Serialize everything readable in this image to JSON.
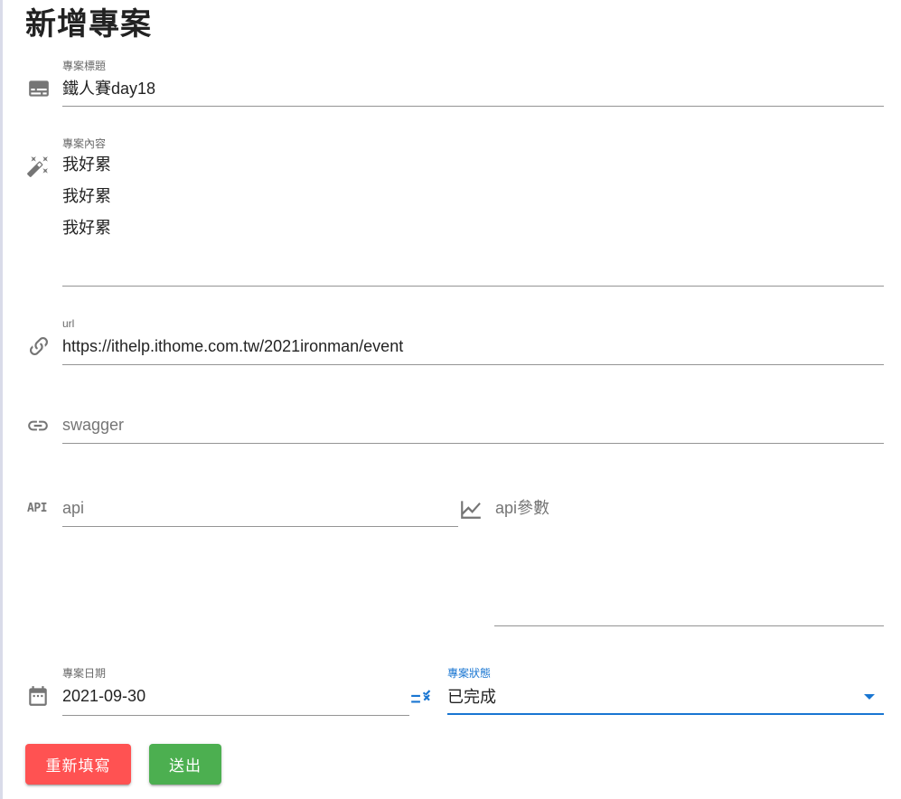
{
  "page": {
    "title": "新增專案"
  },
  "form": {
    "title_field": {
      "label": "專案標題",
      "value": "鐵人賽day18",
      "icon": "subtitles-icon"
    },
    "content_field": {
      "label": "專案內容",
      "lines": [
        "我好累",
        "我好累",
        "我好累"
      ],
      "icon": "auto-fix-icon"
    },
    "url_field": {
      "label": "url",
      "value": "https://ithelp.ithome.com.tw/2021ironman/event",
      "icon": "link-variant-icon"
    },
    "swagger_field": {
      "placeholder": "swagger",
      "icon": "link-icon"
    },
    "api_field": {
      "placeholder": "api",
      "icon": "api-icon",
      "icon_text": "API"
    },
    "api_params_field": {
      "placeholder": "api參數",
      "icon": "chart-line-icon"
    },
    "date_field": {
      "label": "專案日期",
      "value": "2021-09-30",
      "icon": "calendar-icon"
    },
    "status_field": {
      "label": "專案狀態",
      "value": "已完成",
      "icon": "list-status-icon"
    }
  },
  "buttons": {
    "reset_label": "重新填寫",
    "submit_label": "送出"
  },
  "colors": {
    "accent": "#1976d2",
    "reset": "#ff5252",
    "submit": "#4caf50"
  }
}
